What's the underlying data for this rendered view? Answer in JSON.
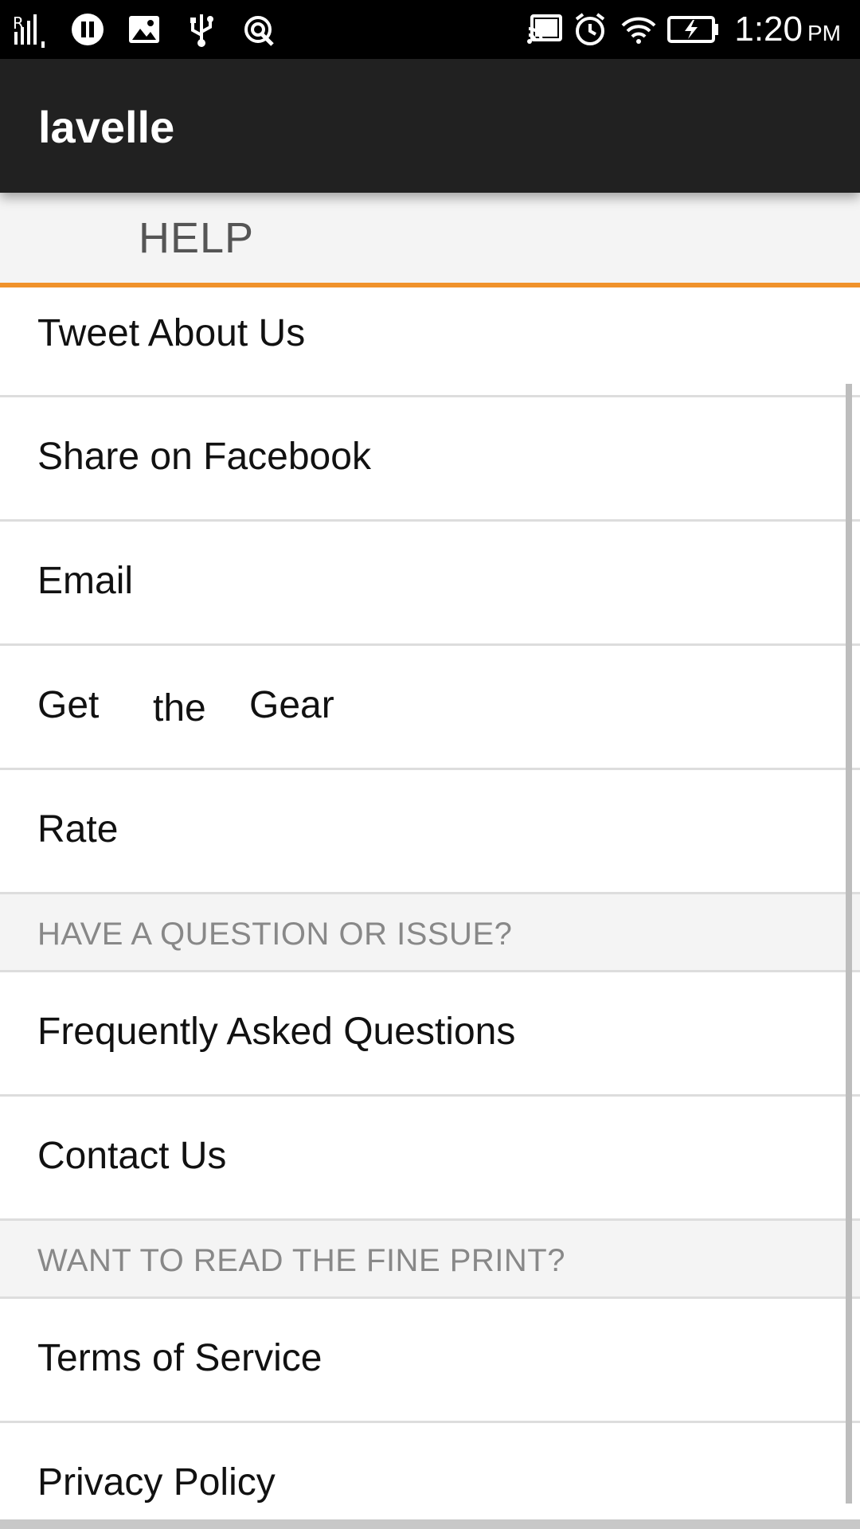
{
  "status_bar": {
    "time": "1:20",
    "ampm": "PM",
    "icons": [
      "signal-icon",
      "pause-icon",
      "image-icon",
      "usb-icon",
      "data-sync-icon",
      "cast-icon",
      "alarm-icon",
      "wifi-icon",
      "battery-charging-icon"
    ]
  },
  "app_bar": {
    "title": "lavelle"
  },
  "tabs": {
    "active": "HELP"
  },
  "list": {
    "items": [
      {
        "label": "Tweet About Us"
      },
      {
        "label": "Share on Facebook"
      },
      {
        "label": "Email"
      },
      {
        "label_parts": [
          "Get",
          "the",
          "Gear"
        ]
      },
      {
        "label": "Rate"
      }
    ],
    "section_question": "HAVE A QUESTION OR ISSUE?",
    "question_items": [
      {
        "label": "Frequently Asked Questions"
      },
      {
        "label": "Contact Us"
      }
    ],
    "section_fine_print": "WANT TO READ THE FINE PRINT?",
    "fine_print_items": [
      {
        "label": "Terms of Service"
      },
      {
        "label": "Privacy Policy"
      }
    ]
  },
  "colors": {
    "status_bar": "#000000",
    "app_bar": "#212121",
    "tab_indicator": "#f0922b",
    "section_bg": "#f4f4f4"
  }
}
